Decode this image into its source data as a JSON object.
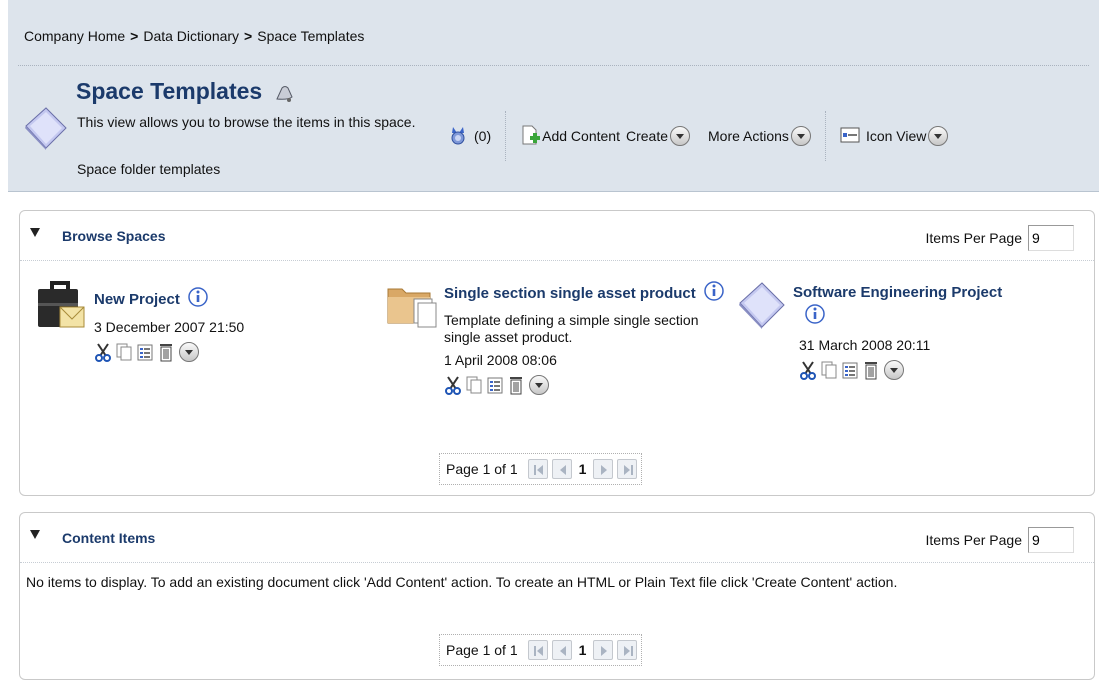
{
  "breadcrumb": {
    "items": [
      "Company Home",
      "Data Dictionary",
      "Space Templates"
    ],
    "separator": ">"
  },
  "header": {
    "title": "Space Templates",
    "description": "This view allows you to browse the items in this space.",
    "subdescription": "Space folder templates",
    "rules_count": "(0)",
    "actions": {
      "add_content": "Add Content",
      "create": "Create",
      "more_actions": "More Actions",
      "view": "Icon View"
    }
  },
  "browse_spaces": {
    "title": "Browse Spaces",
    "items_per_page_label": "Items Per Page",
    "items_per_page": "9",
    "items": [
      {
        "name": "New Project",
        "description": "",
        "date": "3 December 2007 21:50",
        "icon": "briefcase-icon"
      },
      {
        "name": "Single section single asset product",
        "description": "Template defining a simple single section single asset product.",
        "date": "1 April 2008 08:06",
        "icon": "folder-icon"
      },
      {
        "name": "Software Engineering Project",
        "description": "",
        "date": "31 March 2008 20:11",
        "icon": "document-icon"
      }
    ],
    "pager": {
      "label": "Page 1 of 1",
      "current": "1"
    }
  },
  "content_items": {
    "title": "Content Items",
    "items_per_page_label": "Items Per Page",
    "items_per_page": "9",
    "message": "No items to display. To add an existing document click 'Add Content' action. To create an HTML or Plain Text file click 'Create Content' action.",
    "pager": {
      "label": "Page 1 of 1",
      "current": "1"
    }
  },
  "colors": {
    "header_bg": "#dde4ec",
    "link_blue": "#1b3a6b",
    "panel_border": "#c9c9c9"
  }
}
